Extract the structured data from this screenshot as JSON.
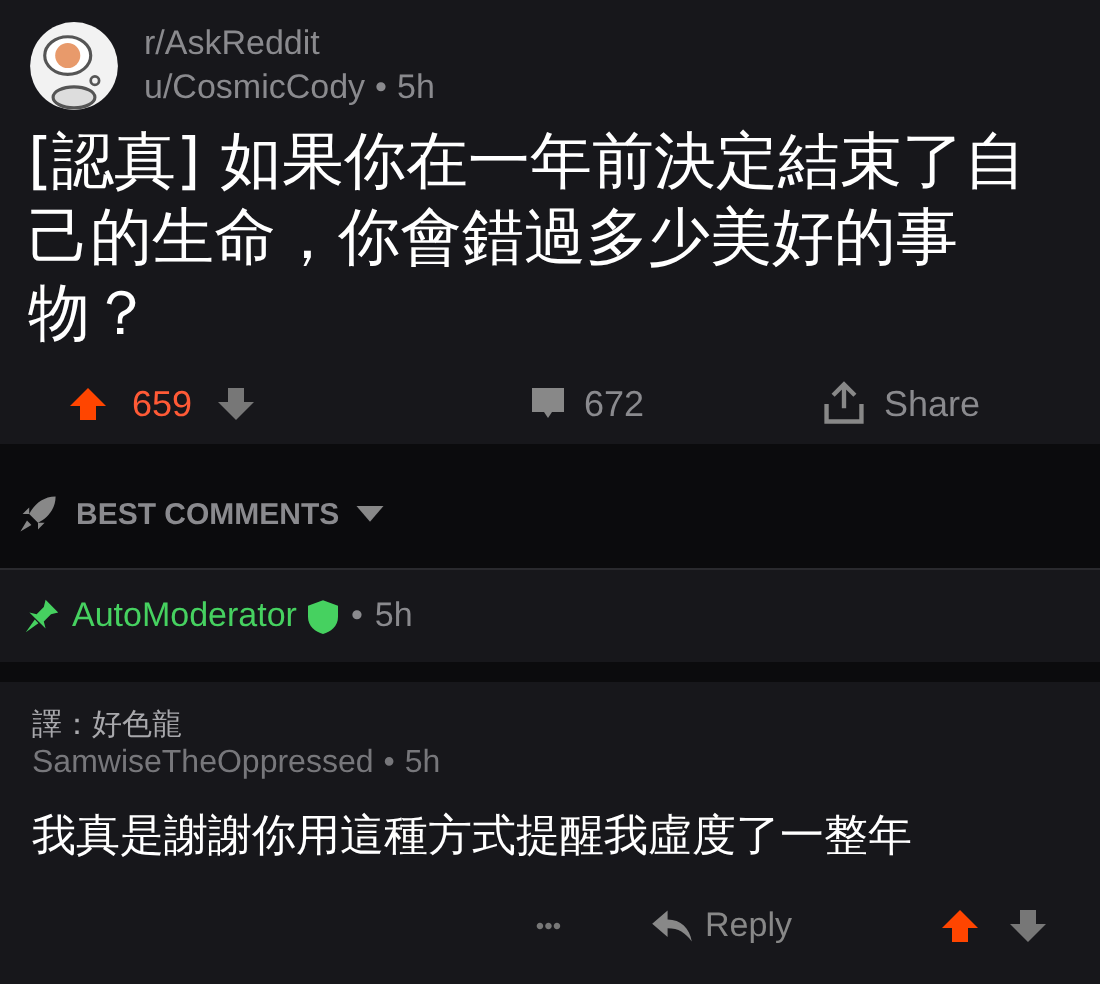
{
  "post": {
    "subreddit": "r/AskReddit",
    "author": "u/CosmicCody",
    "separator": "•",
    "age": "5h",
    "title": "[認真] 如果你在一年前決定結束了自己的生命，你會錯過多少美好的事物？",
    "score": "659",
    "upvoted": true,
    "comments": "672",
    "share": "Share"
  },
  "sort": {
    "label": "BEST COMMENTS"
  },
  "pinned_comment": {
    "author": "AutoModerator",
    "separator": "•",
    "age": "5h",
    "pinned": true,
    "moderator": true
  },
  "comment": {
    "translator_note": "譯：好色龍",
    "author": "SamwiseTheOppressed",
    "separator": "•",
    "age": "5h",
    "text": "我真是謝謝你用這種方式提醒我虛度了一整年",
    "more": "•••",
    "reply": "Reply",
    "upvoted": true
  }
}
